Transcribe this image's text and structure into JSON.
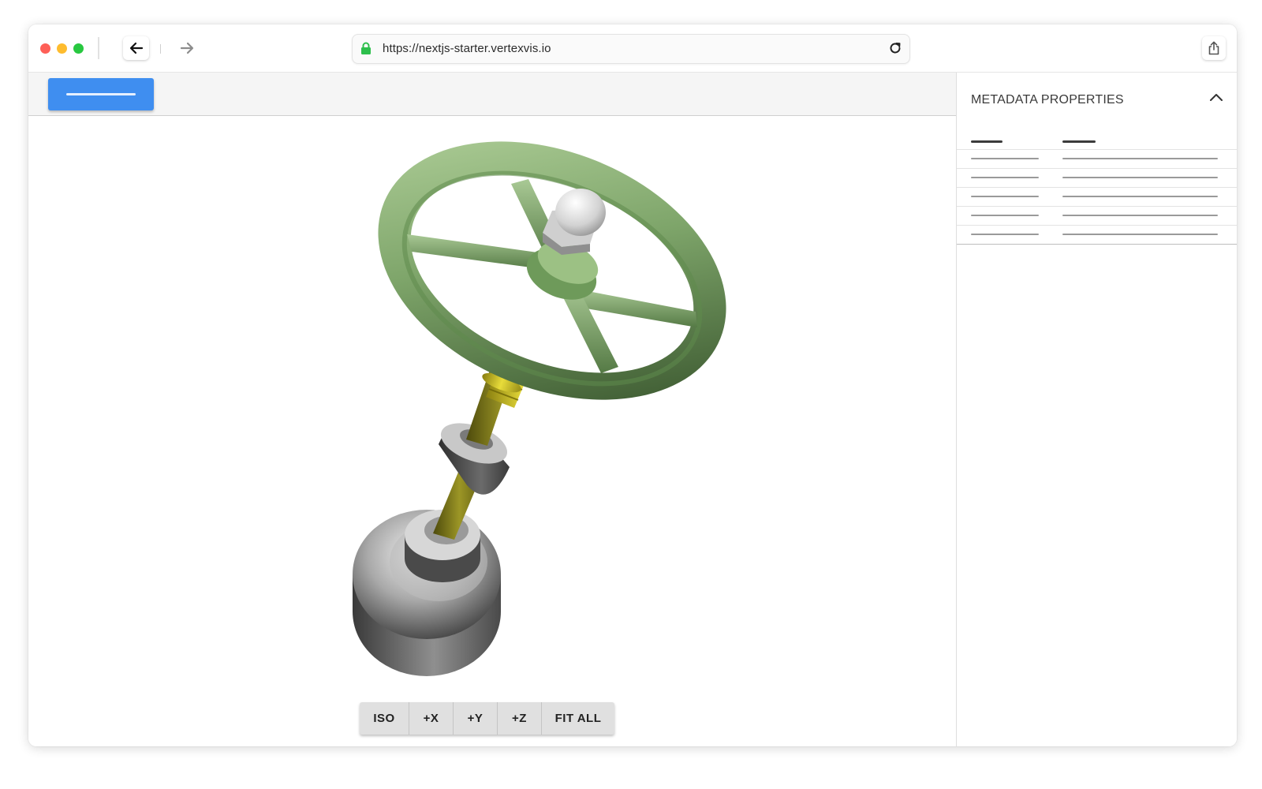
{
  "browser": {
    "url": "https://nextjs-starter.vertexvis.io",
    "traffic_colors": [
      "#fe5f57",
      "#febc2e",
      "#28c840"
    ],
    "icons": [
      "arrow-left-icon",
      "arrow-right-icon",
      "lock-icon",
      "reload-icon",
      "share-icon"
    ]
  },
  "toolbar": {
    "primary_button_color": "#3f8ef0"
  },
  "viewer": {
    "model_description": "",
    "view_buttons": [
      {
        "label": "ISO"
      },
      {
        "label": "+X"
      },
      {
        "label": "+Y"
      },
      {
        "label": "+Z"
      },
      {
        "label": "FIT ALL"
      }
    ]
  },
  "panel": {
    "title": "METADATA PROPERTIES",
    "collapse_icon": "chevron-up-icon",
    "row_count": 5
  }
}
